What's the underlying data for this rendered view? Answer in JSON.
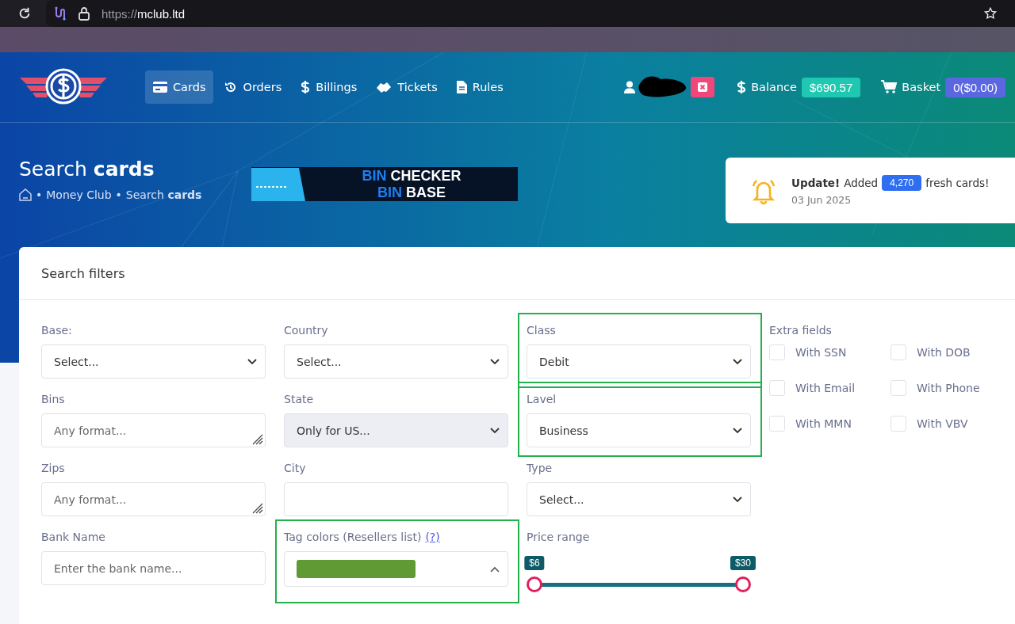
{
  "browser": {
    "url_scheme": "https://",
    "url_host": "mclub.ltd"
  },
  "nav": [
    {
      "label": "Cards",
      "selected": true
    },
    {
      "label": "Orders",
      "selected": false
    },
    {
      "label": "Billings",
      "selected": false
    },
    {
      "label": "Tickets",
      "selected": false
    },
    {
      "label": "Rules",
      "selected": false
    }
  ],
  "balance": {
    "label": "Balance",
    "value": "$690.57"
  },
  "basket": {
    "label": "Basket",
    "value": "0($0.00)"
  },
  "page_title": "Search **cards**",
  "breadcrumb": {
    "separator": "•",
    "items": [
      "Money Club",
      "Search **cards**"
    ]
  },
  "banner": {
    "lines": [
      [
        "BIN",
        "CHECKER"
      ],
      [
        "BIN",
        "BASE"
      ]
    ]
  },
  "notice": {
    "title": "Update!",
    "before": "Added",
    "count": "4,270",
    "after": "fresh cards!",
    "date": "03 Jun 2025"
  },
  "filters": {
    "title": "Search filters",
    "fields": [
      {
        "kind": "select",
        "label": "Base:",
        "value": "Select..."
      },
      {
        "kind": "select",
        "label": "Country",
        "value": "Select..."
      },
      {
        "kind": "select",
        "label": "Class",
        "value": "Debit",
        "highlighted": true
      },
      {
        "kind": "textarea",
        "label": "Bins",
        "placeholder": "Any format..."
      },
      {
        "kind": "select",
        "label": "State",
        "value": "Only for US...",
        "disabled": true
      },
      {
        "kind": "select",
        "label": "Lavel",
        "value": "Business",
        "highlighted": true
      },
      {
        "kind": "textarea",
        "label": "Zips",
        "placeholder": "Any format..."
      },
      {
        "kind": "input",
        "label": "City"
      },
      {
        "kind": "select",
        "label": "Type",
        "value": "Select..."
      },
      {
        "kind": "input",
        "label": "Bank Name",
        "placeholder": "Enter the bank name..."
      },
      {
        "kind": "tags",
        "label": "Tag colors (Resellers list)",
        "link": "(?)",
        "open": true,
        "tags": [
          {
            "color": "#5f9a35"
          }
        ],
        "highlighted": true
      },
      {
        "kind": "range",
        "label": "Price range",
        "handles": [
          {
            "label": "$6",
            "level": 0
          },
          {
            "label": "$30",
            "level": 1
          }
        ]
      }
    ],
    "extra": {
      "label": "Extra fields",
      "options": [
        {
          "label": "With SSN",
          "checked": false
        },
        {
          "label": "With DOB",
          "checked": false
        },
        {
          "label": "With Email",
          "checked": false
        },
        {
          "label": "With Phone",
          "checked": false
        },
        {
          "label": "With MMN",
          "checked": false
        },
        {
          "label": "With VBV",
          "checked": false
        }
      ]
    }
  }
}
